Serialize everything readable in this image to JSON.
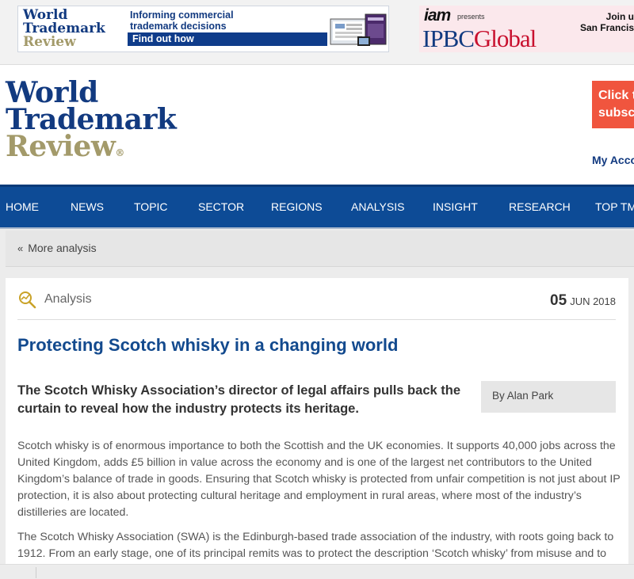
{
  "ad_left": {
    "logo_line1": "World",
    "logo_line2": "Trademark",
    "logo_line3": "Review",
    "tagline_line1": "Informing commercial",
    "tagline_line2": "trademark decisions",
    "cta": "Find out how"
  },
  "ad_right": {
    "brand": "iam",
    "presents": "presents",
    "event_part1": "IPBC",
    "event_part2": "Global",
    "text_line1": "Join u",
    "text_line2": "San Francis"
  },
  "header": {
    "logo_line1": "World",
    "logo_line2": "Trademark",
    "logo_line3": "Review",
    "subscribe_line1": "Click t",
    "subscribe_line2": "subsc",
    "my_account": "My Acco"
  },
  "nav": {
    "items": [
      "HOME",
      "NEWS",
      "TOPIC",
      "SECTOR",
      "REGIONS",
      "ANALYSIS",
      "INSIGHT",
      "RESEARCH",
      "TOP TM"
    ]
  },
  "breadcrumb": {
    "label": "More analysis"
  },
  "article": {
    "category": "Analysis",
    "date_day": "05",
    "date_month_year": "JUN 2018",
    "title": "Protecting Scotch whisky in a changing world",
    "standfirst": "The Scotch Whisky Association’s director of legal affairs pulls back the curtain to reveal how the industry protects its heritage.",
    "byline": "By Alan Park",
    "paragraphs": [
      "Scotch whisky is of enormous importance to both the Scottish and the UK economies. It supports 40,000 jobs across the United Kingdom, adds £5 billion in value across the economy and is one of the largest net contributors to the United Kingdom’s balance of trade in goods.  Ensuring that Scotch whisky is protected from unfair competition is not just about IP protection, it is also about protecting cultural heritage and employment in rural areas, where most of the industry’s distilleries are located.",
      "The Scotch Whisky Association (SWA) is the Edinburgh-based trade association of the industry, with roots going back to 1912. From an early stage, one of its principal remits was to protect the description ‘Scotch whisky’ from misuse and to ensure that it could not become a generic term."
    ]
  },
  "colors": {
    "brand_blue": "#123a80",
    "nav_blue": "#0d4b96",
    "subscribe_orange": "#f0553e",
    "title_blue": "#134a8e",
    "review_gold": "#a39a6a"
  }
}
